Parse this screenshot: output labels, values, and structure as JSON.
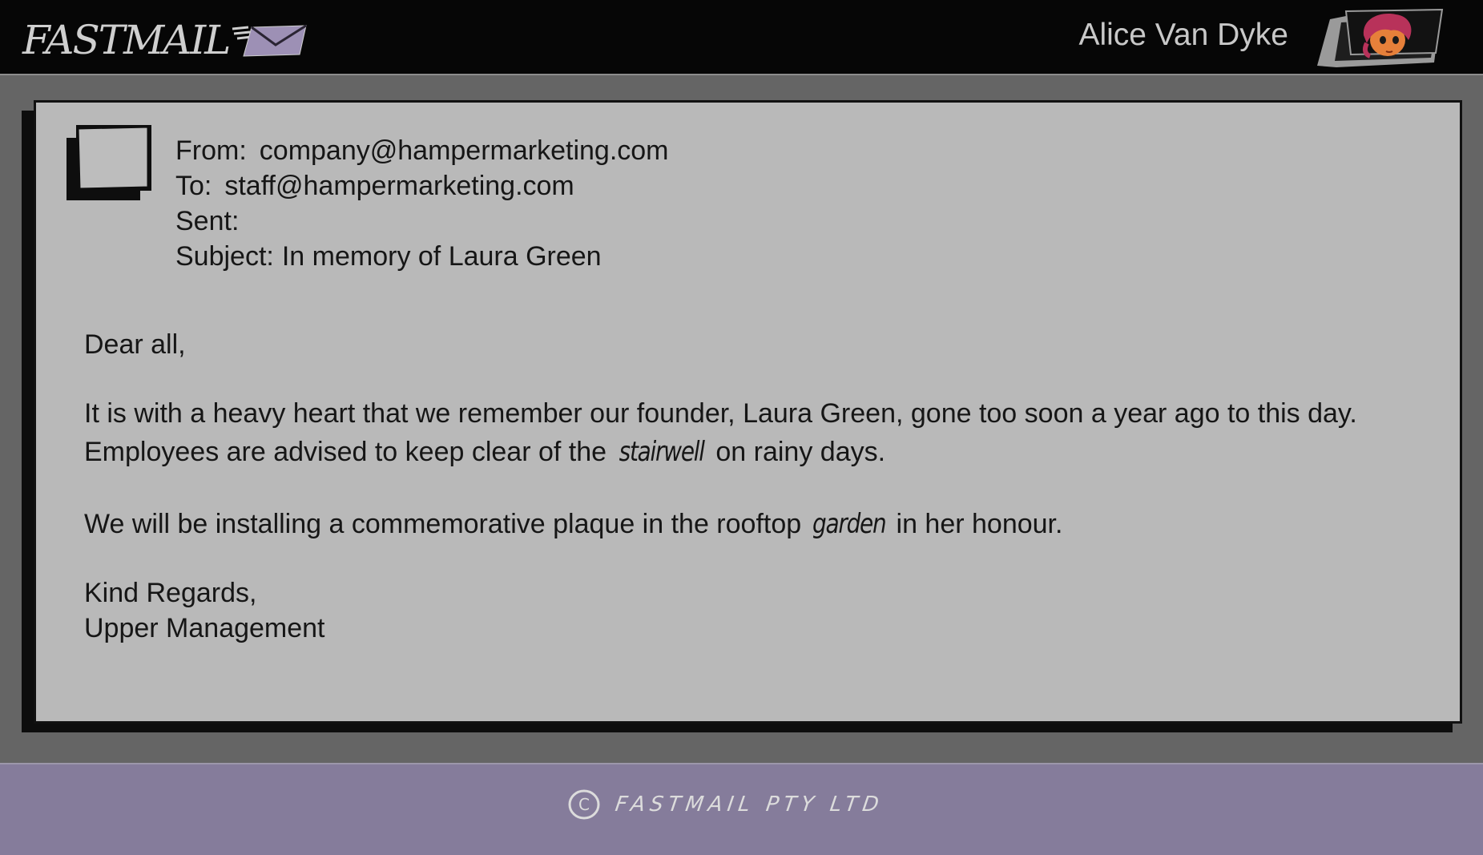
{
  "app": {
    "logo_text": "FASTMAIL",
    "user_name": "Alice Van Dyke"
  },
  "email": {
    "from_label": "From:",
    "from_value": "company@hampermarketing.com",
    "to_label": "To:",
    "to_value": "staff@hampermarketing.com",
    "sent_label": "Sent:",
    "sent_value": "",
    "subject_label": "Subject:",
    "subject_value": "In memory of Laura Green",
    "greeting": "Dear all,",
    "para1_line1": "It is with a heavy heart that we remember our founder, Laura Green, gone too soon a year ago to this day.",
    "para1_line2_before": "Employees are advised to keep clear of the ",
    "para1_line2_hand": "stairwell",
    "para1_line2_after": " on rainy days.",
    "para2_before": "We will be installing a commemorative plaque in the rooftop ",
    "para2_hand": "garden",
    "para2_after": " in her honour.",
    "signoff": "Kind Regards,",
    "signature": "Upper Management"
  },
  "footer": {
    "copyright_symbol": "C",
    "text": "FASTMAIL PTY LTD"
  },
  "colors": {
    "topbar": "#060606",
    "background": "#656565",
    "card": "#b9b9b9",
    "footer": "#857c9b",
    "envelope": "#9d90b5"
  },
  "icons": {
    "logo": "envelope-icon",
    "avatar": "user-avatar",
    "sender": "sender-avatar-placeholder",
    "copyright": "copyright-icon"
  }
}
